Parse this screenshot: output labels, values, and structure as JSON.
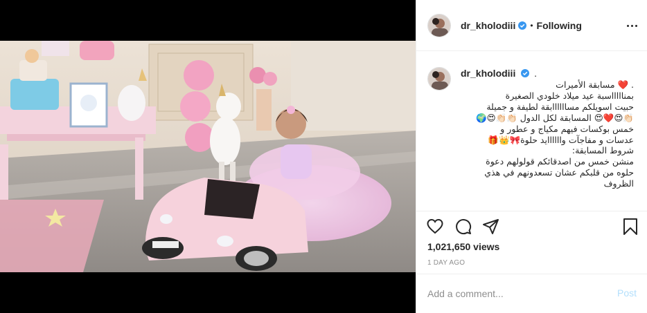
{
  "post": {
    "username": "dr_kholodiii",
    "separator": "•",
    "follow_status": "Following",
    "verified_icon": "verified-badge-icon",
    "accent": "#3897f0"
  },
  "caption": {
    "username": "dr_kholodiii",
    "trailing": ".",
    "lines": [
      ". ❤️ مسابقة الأميرات",
      "بمناااااسبة عيد ميلاد خلودي الصغيرة",
      "حبيت اسويلكم مساااااابقة لطيفة و جميلة",
      "👏🏻😍❤️😍 المسابقة لكل الدول 👏🏻👏🏻😍🌍",
      "خمس بوكسات فيهم مكياج و عطور و",
      "عدسات و مفاجآت واااااايد حلوة🎀👑🎁",
      "شروط المسابقة:",
      "منشن خمس من اصدقائكم قولولهم دعوة",
      "حلوه من قلبكم عشان تسعدونهم في هذي",
      "الظروف"
    ]
  },
  "stats": {
    "views": "1,021,650 views",
    "time_ago": "1 DAY AGO"
  },
  "comment": {
    "placeholder": "Add a comment...",
    "post_label": "Post",
    "post_color": "#b2dffc"
  },
  "icons": {
    "like": "heart-icon",
    "comment": "comment-icon",
    "share": "share-icon",
    "save": "bookmark-icon",
    "more": "more-options-icon"
  }
}
